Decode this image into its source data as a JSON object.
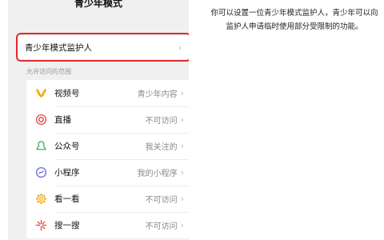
{
  "page": {
    "title": "青少年模式"
  },
  "guardian": {
    "label": "青少年模式监护人",
    "chevron": "›"
  },
  "section_label": "允许访问的范围",
  "items": [
    {
      "label": "视频号",
      "value": "青少年内容",
      "icon": "channels-icon",
      "color": "#f0a500"
    },
    {
      "label": "直播",
      "value": "不可访问",
      "icon": "live-icon",
      "color": "#e8453c"
    },
    {
      "label": "公众号",
      "value": "我关注的",
      "icon": "official-account-icon",
      "color": "#3cb34a"
    },
    {
      "label": "小程序",
      "value": "我的小程序",
      "icon": "mini-program-icon",
      "color": "#6a6ad8"
    },
    {
      "label": "看一看",
      "value": "不可访问",
      "icon": "top-stories-icon",
      "color": "#f0a500"
    },
    {
      "label": "搜一搜",
      "value": "不可访问",
      "icon": "search-icon",
      "color": "#e8453c"
    }
  ],
  "chevron": "›",
  "description": "你可以设置一位青少年模式监护人，青少年可以向监护人申请临时使用部分受限制的功能。",
  "colors": {
    "highlight": "#e02b2b",
    "background": "#f0f0f0"
  }
}
